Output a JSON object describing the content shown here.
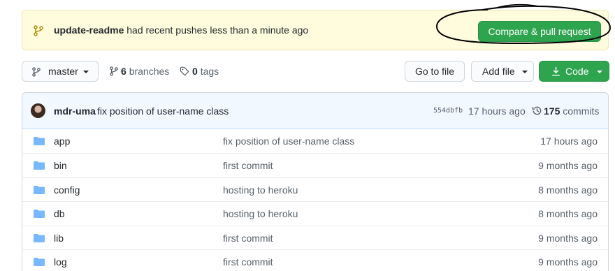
{
  "banner": {
    "branch_name": "update-readme",
    "message": "had recent pushes less than a minute ago",
    "button_label": "Compare & pull request"
  },
  "toolbar": {
    "branch_select": "master",
    "branches_count": "6",
    "branches_label": "branches",
    "tags_count": "0",
    "tags_label": "tags",
    "goto_file": "Go to file",
    "add_file": "Add file",
    "code": "Code"
  },
  "latest_commit": {
    "author": "mdr-uma",
    "message": "fix position of user-name class",
    "sha": "554dbfb",
    "time": "17 hours ago",
    "commit_count": "175",
    "commit_label": "commits"
  },
  "files": [
    {
      "name": "app",
      "message": "fix position of user-name class",
      "age": "17 hours ago"
    },
    {
      "name": "bin",
      "message": "first commit",
      "age": "9 months ago"
    },
    {
      "name": "config",
      "message": "hosting to heroku",
      "age": "8 months ago"
    },
    {
      "name": "db",
      "message": "hosting to heroku",
      "age": "8 months ago"
    },
    {
      "name": "lib",
      "message": "first commit",
      "age": "9 months ago"
    },
    {
      "name": "log",
      "message": "first commit",
      "age": "9 months ago"
    }
  ],
  "colors": {
    "banner_bg": "#fffbdd",
    "primary_green": "#2ea44f",
    "folder_blue": "#79b8ff",
    "commit_bar_bg": "#f1f8ff"
  },
  "icons": [
    "git-branch-icon",
    "caret-down-icon",
    "tag-icon",
    "download-icon",
    "history-icon",
    "folder-icon"
  ]
}
